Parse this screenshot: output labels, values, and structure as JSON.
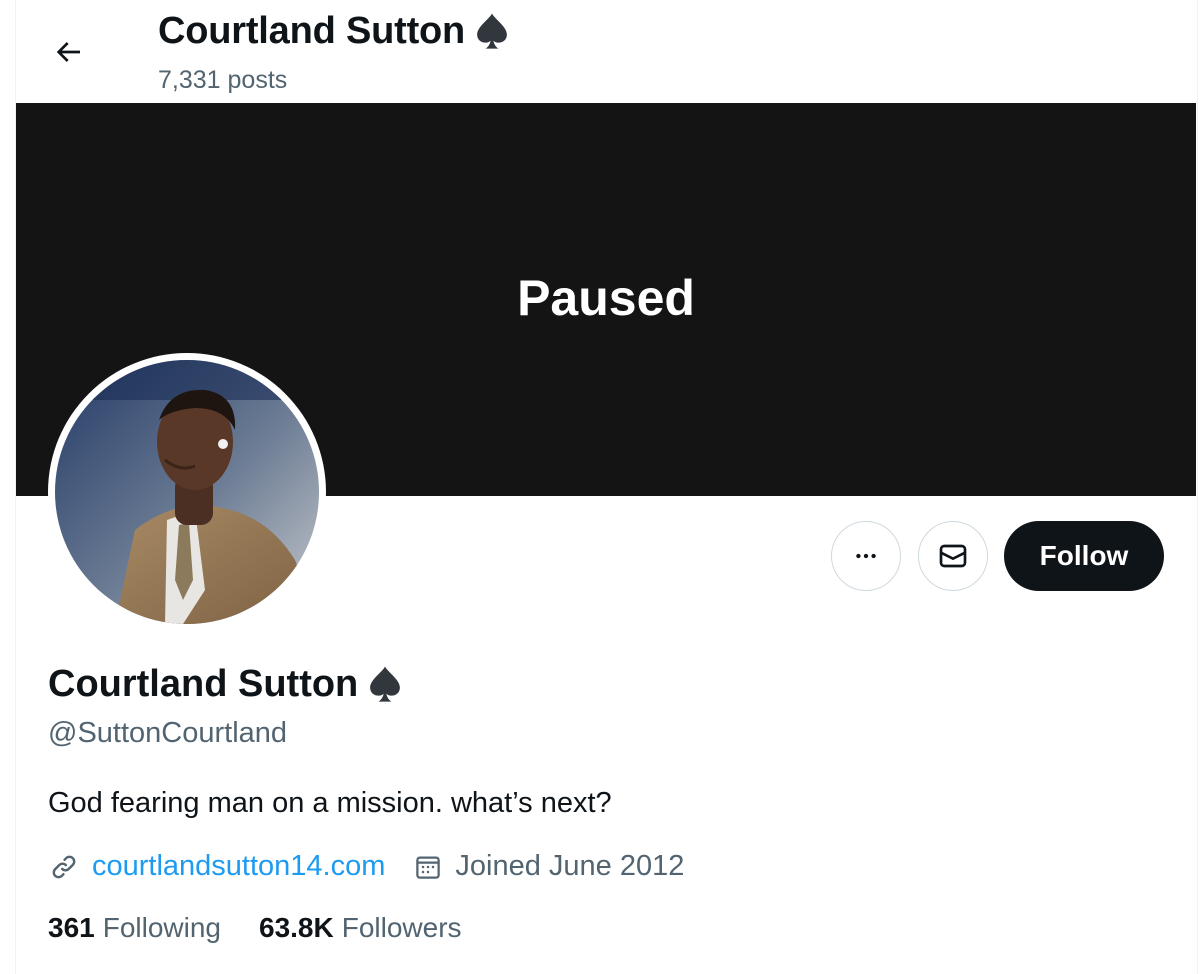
{
  "header": {
    "name": "Courtland Sutton",
    "posts_count": "7,331 posts"
  },
  "banner": {
    "overlay_text": "Paused"
  },
  "profile": {
    "display_name": "Courtland Sutton",
    "handle": "@SuttonCourtland",
    "bio": "God fearing man on a mission. what’s next?",
    "website": "courtlandsutton14.com",
    "joined": "Joined June 2012",
    "following_count": "361",
    "following_label": "Following",
    "followers_count": "63.8K",
    "followers_label": "Followers"
  },
  "actions": {
    "follow_label": "Follow"
  },
  "icons": {
    "back": "back-arrow-icon",
    "more": "more-horizontal-icon",
    "message": "mail-icon",
    "link": "link-icon",
    "calendar": "calendar-icon",
    "name_emoji": "spade-icon"
  },
  "colors": {
    "text": "#0f1419",
    "secondary": "#536471",
    "link": "#1d9bf0",
    "banner": "#141414",
    "follow_bg": "#0f1419"
  }
}
